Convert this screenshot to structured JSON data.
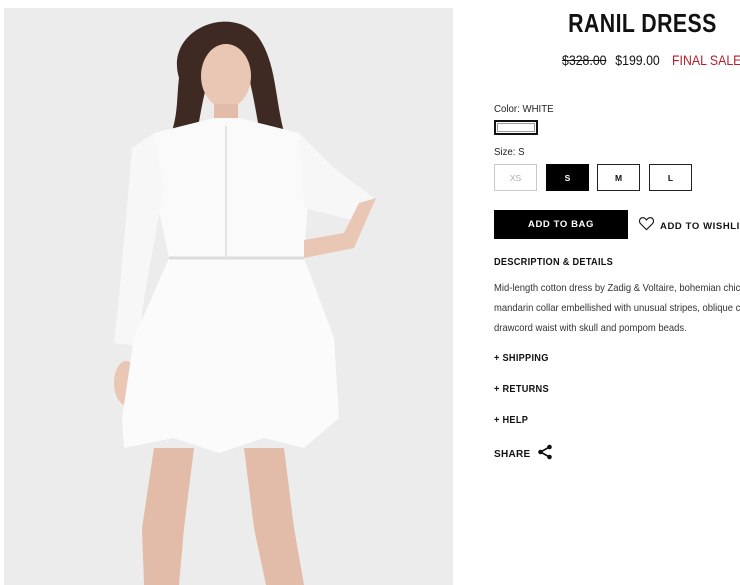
{
  "product": {
    "title": "RANIL DRESS",
    "price_original": "$328.00",
    "price_current": "$199.00",
    "sale_label": "FINAL SALE",
    "sale_color": "#b3202c",
    "image_alt": "Model wearing white Ranil dress"
  },
  "color": {
    "label": "Color: WHITE",
    "swatch_value": "#ffffff"
  },
  "size": {
    "label": "Size: S",
    "options": [
      {
        "label": "XS",
        "state": "unavailable"
      },
      {
        "label": "S",
        "state": "selected"
      },
      {
        "label": "M",
        "state": "available"
      },
      {
        "label": "L",
        "state": "available"
      }
    ]
  },
  "actions": {
    "add_to_bag": "ADD TO BAG",
    "add_to_wishlist": "ADD TO WISHLIST"
  },
  "description": {
    "title": "DESCRIPTION & DETAILS",
    "lines": [
      "Mid-length cotton dress by Zadig & Voltaire, bohemian chic",
      "mandarin collar embellished with unusual stripes, oblique c",
      "drawcord waist with skull and pompom beads."
    ]
  },
  "accordions": {
    "shipping": "+ SHIPPING",
    "returns": "+ RETURNS",
    "help": "+ HELP"
  },
  "share": {
    "label": "SHARE"
  },
  "icons": {
    "wishlist": "heart-outline-icon",
    "share": "share-nodes-icon"
  }
}
